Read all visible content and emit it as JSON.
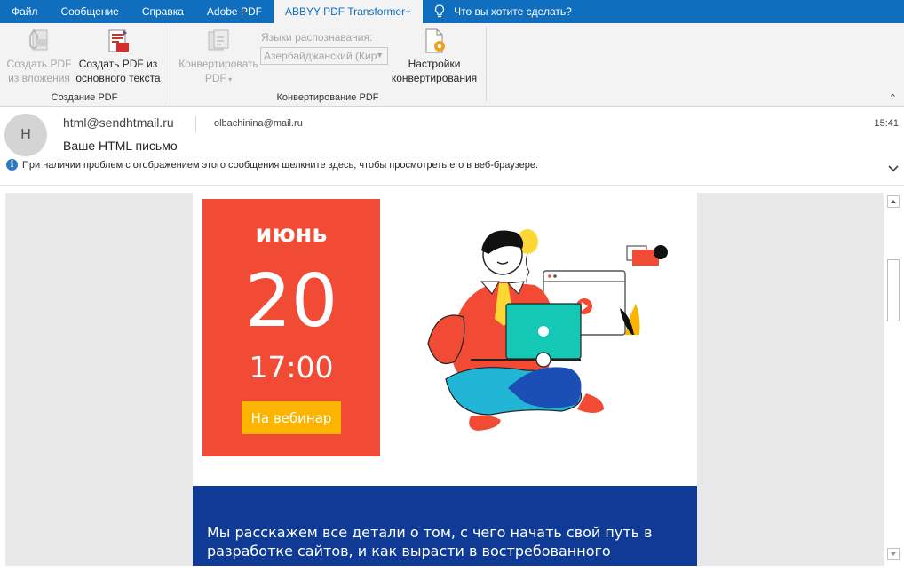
{
  "ribbon_tabs": [
    {
      "label": "Файл"
    },
    {
      "label": "Сообщение"
    },
    {
      "label": "Справка"
    },
    {
      "label": "Adobe PDF"
    },
    {
      "label": "ABBYY PDF Transformer+",
      "active": true
    }
  ],
  "tell_me": "Что вы хотите сделать?",
  "ribbon": {
    "btn_attach": "Создать PDF из вложения",
    "btn_body": "Создать PDF из основного текста",
    "group_create": "Создание PDF",
    "btn_convert": "Конвертировать PDF",
    "lang_label": "Языки распознавания:",
    "lang_value": "Азербайджанский (Кир",
    "btn_settings": "Настройки конвертирования",
    "group_convert": "Конвертирование PDF"
  },
  "message": {
    "avatar_letter": "H",
    "from": "html@sendhtmail.ru",
    "to": "olbachinina@mail.ru",
    "time": "15:41",
    "subject": "Ваше HTML письмо",
    "info": "При наличии проблем с отображением этого сообщения щелкните здесь, чтобы просмотреть его в веб-браузере."
  },
  "email": {
    "month": "июнь",
    "day": "20",
    "time": "17:00",
    "cta": "На вебинар",
    "blue_text": "Мы расскажем все детали о том, с чего начать свой путь в разработке сайтов, и как вырасти в востребованного"
  },
  "colors": {
    "tabbar": "#106ebe",
    "date_box": "#f24b35",
    "cta_button": "#fbb400",
    "blue_block": "#0f3b96"
  }
}
